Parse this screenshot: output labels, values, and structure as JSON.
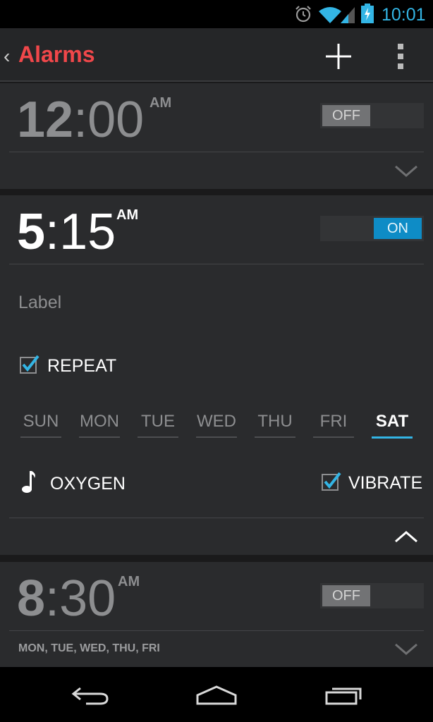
{
  "status_bar": {
    "time": "10:01",
    "icons": [
      "alarm-icon",
      "wifi-icon",
      "cell-signal-icon",
      "battery-charging-icon"
    ],
    "accent_color": "#33b5e5"
  },
  "action_bar": {
    "title": "Alarms",
    "title_color": "#f0474a",
    "actions": [
      "add-icon",
      "overflow-menu-icon"
    ]
  },
  "alarms": [
    {
      "hour": "12",
      "minutes": "00",
      "ampm": "AM",
      "toggle_label": "OFF",
      "enabled": false,
      "expanded": false
    },
    {
      "hour": "5",
      "minutes": "15",
      "ampm": "AM",
      "toggle_label": "ON",
      "enabled": true,
      "expanded": true,
      "label_placeholder": "Label",
      "repeat_label": "REPEAT",
      "repeat_checked": true,
      "days": [
        {
          "name": "SUN",
          "selected": false
        },
        {
          "name": "MON",
          "selected": false
        },
        {
          "name": "TUE",
          "selected": false
        },
        {
          "name": "WED",
          "selected": false
        },
        {
          "name": "THU",
          "selected": false
        },
        {
          "name": "FRI",
          "selected": false
        },
        {
          "name": "SAT",
          "selected": true
        }
      ],
      "ringtone": "OXYGEN",
      "vibrate_label": "VIBRATE",
      "vibrate_checked": true
    },
    {
      "hour": "8",
      "minutes": "30",
      "ampm": "AM",
      "toggle_label": "OFF",
      "enabled": false,
      "expanded": false,
      "days_summary": "MON, TUE, WED, THU, FRI"
    }
  ],
  "nav_bar": {
    "buttons": [
      "back-icon",
      "home-icon",
      "recent-apps-icon"
    ]
  },
  "colors": {
    "on_toggle": "#0e8cc6",
    "off_toggle": "#727375",
    "checkbox_check": "#33b5e5"
  }
}
